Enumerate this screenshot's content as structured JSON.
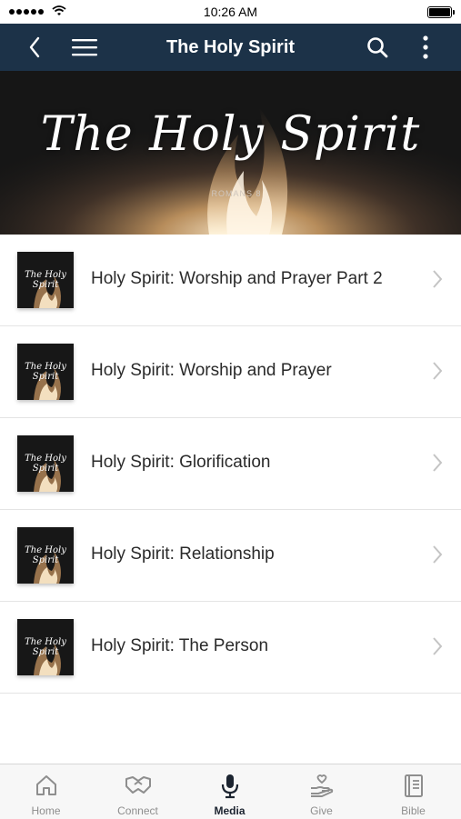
{
  "status_bar": {
    "time": "10:26 AM"
  },
  "nav": {
    "title": "The Holy Spirit",
    "back_icon": "chevron-left-icon",
    "menu_icon": "hamburger-menu-icon",
    "search_icon": "search-icon",
    "more_icon": "more-vertical-icon"
  },
  "banner": {
    "title": "The Holy Spirit",
    "subtitle": "ROMANS 8"
  },
  "media": {
    "items": [
      {
        "title": "Holy Spirit: Worship and Prayer Part 2",
        "thumb_text": "The Holy Spirit"
      },
      {
        "title": "Holy Spirit: Worship and Prayer",
        "thumb_text": "The Holy Spirit"
      },
      {
        "title": "Holy Spirit: Glorification",
        "thumb_text": "The Holy Spirit"
      },
      {
        "title": "Holy Spirit: Relationship",
        "thumb_text": "The Holy Spirit"
      },
      {
        "title": "Holy Spirit: The Person",
        "thumb_text": "The Holy Spirit"
      }
    ]
  },
  "tabs": [
    {
      "label": "Home",
      "icon": "home-icon"
    },
    {
      "label": "Connect",
      "icon": "handshake-icon"
    },
    {
      "label": "Media",
      "icon": "microphone-icon",
      "active": true
    },
    {
      "label": "Give",
      "icon": "give-hand-icon"
    },
    {
      "label": "Bible",
      "icon": "book-icon"
    }
  ],
  "colors": {
    "nav_background": "#1c3248",
    "tab_active": "#1c2430",
    "tab_inactive": "#8e8e8e"
  }
}
